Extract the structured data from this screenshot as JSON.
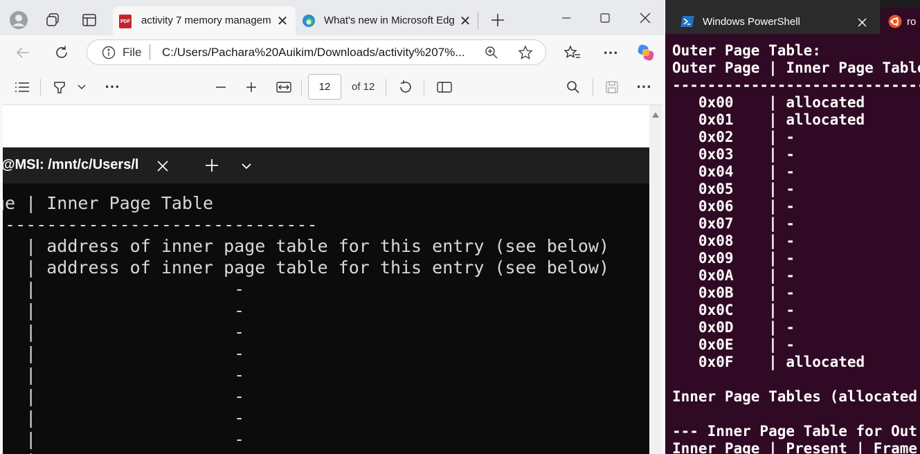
{
  "edge": {
    "tabs": [
      {
        "title": "activity 7 memory managem",
        "icon": "pdf-icon"
      },
      {
        "title": "What's new in Microsoft Edg",
        "icon": "edge-icon"
      }
    ],
    "address": {
      "scheme": "File",
      "url": "C:/Users/Pachara%20Auikim/Downloads/activity%207%..."
    },
    "pdf_toolbar": {
      "page_number": "12",
      "page_count": "of 12"
    },
    "embedded_terminal": {
      "tab_title": "@MSI: /mnt/c/Users/l",
      "lines": [
        "ge | Inner Page Table",
        "-------------------------------",
        "   | address of inner page table for this entry (see below)",
        "   | address of inner page table for this entry (see below)",
        "   |                   -",
        "   |                   -",
        "   |                   -",
        "   |                   -",
        "   |                   -",
        "   |                   -",
        "   |                   -",
        "   |                   -",
        "   |"
      ]
    }
  },
  "powershell": {
    "tab_title": "Windows PowerShell",
    "tab2_title": "ro",
    "lines": [
      "Outer Page Table:",
      "Outer Page | Inner Page Table",
      "------------------------------------",
      "   0x00    | allocated",
      "   0x01    | allocated",
      "   0x02    | -",
      "   0x03    | -",
      "   0x04    | -",
      "   0x05    | -",
      "   0x06    | -",
      "   0x07    | -",
      "   0x08    | -",
      "   0x09    | -",
      "   0x0A    | -",
      "   0x0B    | -",
      "   0x0C    | -",
      "   0x0D    | -",
      "   0x0E    | -",
      "   0x0F    | allocated",
      "",
      "Inner Page Tables (allocated",
      "",
      "--- Inner Page Table for Out",
      "Inner Page | Present | Frame"
    ]
  },
  "colors": {
    "ps_background": "#300a24",
    "terminal_background": "#0c0c0c",
    "edge_chrome": "#e9eaee"
  }
}
